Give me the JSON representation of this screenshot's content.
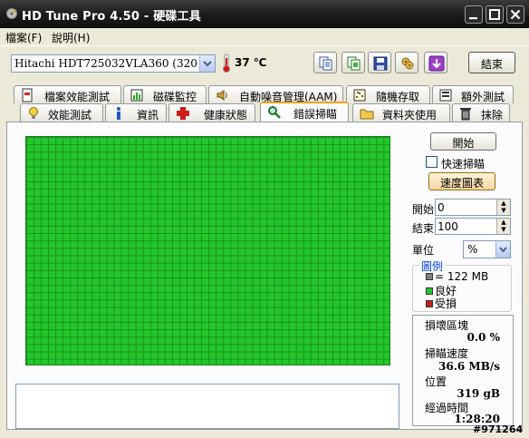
{
  "window": {
    "title": "HD Tune Pro 4.50 - 硬碟工具"
  },
  "menu": {
    "items": [
      {
        "label": "檔案(F)"
      },
      {
        "label": "說明(H)"
      }
    ]
  },
  "toolbar": {
    "drive": "Hitachi HDT725032VLA360 (320 gB)",
    "temperature": "37 ℃",
    "exit_label": "結束",
    "icons": [
      "copy-text-icon",
      "copy-screenshot-icon",
      "save-icon",
      "options-icon",
      "download-icon"
    ]
  },
  "tabs": {
    "row1": [
      {
        "label": "檔案效能測試",
        "icon": "file-benchmark-icon"
      },
      {
        "label": "磁碟監控",
        "icon": "disk-monitor-icon"
      },
      {
        "label": "自動噪音管理(AAM)",
        "icon": "speaker-icon"
      },
      {
        "label": "隨機存取",
        "icon": "random-access-icon"
      },
      {
        "label": "額外測試",
        "icon": "extra-tests-icon"
      }
    ],
    "row2": [
      {
        "label": "效能測試",
        "icon": "bulb-icon"
      },
      {
        "label": "資訊",
        "icon": "info-icon"
      },
      {
        "label": "健康狀態",
        "icon": "health-cross-icon"
      },
      {
        "label": "錯誤掃瞄",
        "icon": "magnifier-icon",
        "active": true
      },
      {
        "label": "資料夾使用",
        "icon": "folder-icon"
      },
      {
        "label": "抹除",
        "icon": "trash-icon"
      }
    ]
  },
  "error_scan": {
    "start_button": "開始",
    "quick_scan_label": "快速掃瞄",
    "quick_scan_checked": false,
    "speed_map_button": "速度圖表",
    "start_label": "開始",
    "start_value": "0",
    "end_label": "結束",
    "end_value": "100",
    "unit_label": "單位",
    "unit_value": "%",
    "block_status": "all-good",
    "block_color_good": "#22c72a",
    "block_color_damaged": "#c8201c"
  },
  "legend": {
    "title": "圖例",
    "items": [
      {
        "label": "= 122 MB",
        "color": "#808080"
      },
      {
        "label": "良好",
        "color": "#22c72a"
      },
      {
        "label": "受損",
        "color": "#c8201c"
      }
    ]
  },
  "stats": {
    "damaged_label": "損壞區塊",
    "damaged_value": "0.0 %",
    "speed_label": "掃瞄速度",
    "speed_value": "36.6 MB/s",
    "position_label": "位置",
    "position_value": "319 gB",
    "elapsed_label": "經過時間",
    "elapsed_value": "1:28:20"
  },
  "watermark": "#971264"
}
